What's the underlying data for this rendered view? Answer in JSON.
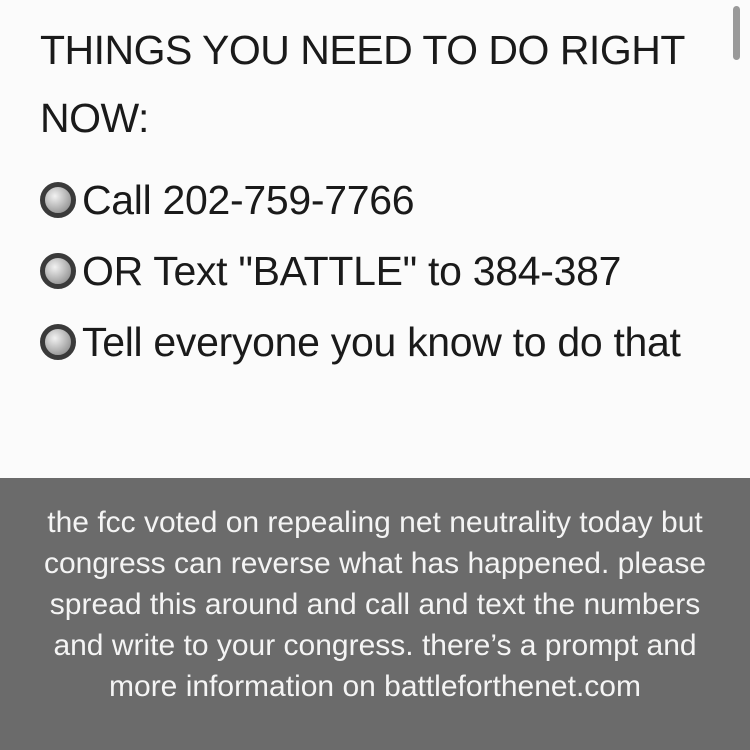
{
  "note": {
    "heading": "THINGS YOU NEED TO DO RIGHT NOW:",
    "items": [
      {
        "icon": "radio-circle-icon",
        "text": "Call 202-759-7766"
      },
      {
        "icon": "radio-circle-icon",
        "text": "OR Text \"BATTLE\" to 384-387"
      },
      {
        "icon": "radio-circle-icon",
        "text": "Tell everyone you know to do that"
      }
    ]
  },
  "caption": {
    "text": "the fcc voted on repealing net neutrality today but congress can reverse what has happened. please spread this around and call and text the numbers and write to your congress. there’s a prompt and more information on battleforthenet.com"
  },
  "colors": {
    "note_background": "#fbfbfb",
    "caption_background": "#6b6b6b",
    "caption_text": "#f4f4f4",
    "body_text": "#1a1a1a"
  }
}
